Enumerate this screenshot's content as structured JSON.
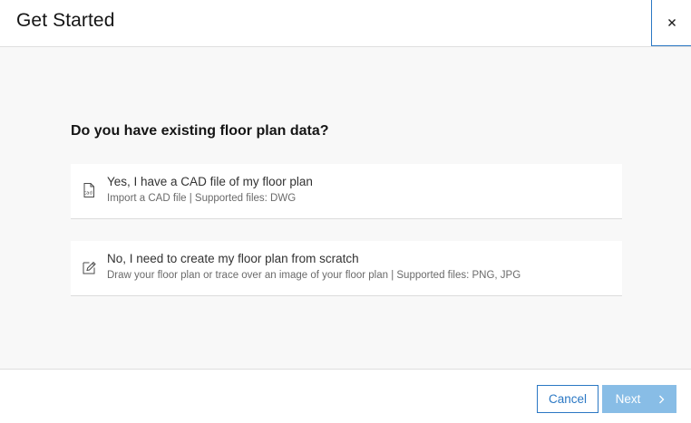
{
  "dialog": {
    "title": "Get Started",
    "close_icon": "close-icon"
  },
  "main": {
    "question": "Do you have existing floor plan data?",
    "options": [
      {
        "icon": "cad-file-icon",
        "title": "Yes, I have a CAD file of my floor plan",
        "description": "Import a CAD file | Supported files: DWG"
      },
      {
        "icon": "edit-pencil-icon",
        "title": "No, I need to create my floor plan from scratch",
        "description": "Draw your floor plan or trace over an image of your floor plan | Supported files: PNG, JPG"
      }
    ]
  },
  "footer": {
    "cancel_label": "Cancel",
    "next_label": "Next",
    "next_icon": "chevron-right-icon"
  },
  "colors": {
    "accent": "#2b78c4",
    "next_disabled_bg": "#88bde6",
    "content_bg": "#f8f8f8"
  }
}
